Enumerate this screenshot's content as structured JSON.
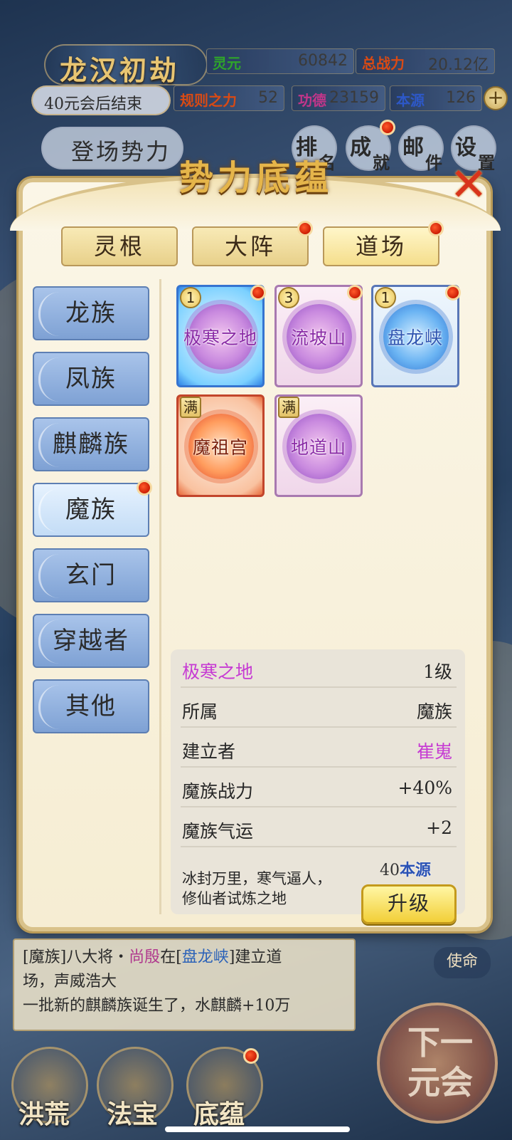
{
  "header": {
    "era_title": "龙汉初劫",
    "countdown": "40元会后结束",
    "forces_button": "登场势力",
    "stats": [
      {
        "label": "灵元",
        "value": "60842",
        "color": "#2fa52a"
      },
      {
        "label": "总战力",
        "value": "20.12亿",
        "color": "#d94a14"
      },
      {
        "label": "规则之力",
        "value": "52",
        "color": "#d94a14"
      },
      {
        "label": "功德",
        "value": "23159",
        "color": "#c2368a"
      },
      {
        "label": "本源",
        "value": "126",
        "color": "#2d58c8"
      }
    ],
    "plus": "+",
    "menu": [
      {
        "a": "排",
        "b": "名"
      },
      {
        "a": "成",
        "b": "就"
      },
      {
        "a": "邮",
        "b": "件"
      },
      {
        "a": "设",
        "b": "置"
      }
    ]
  },
  "modal": {
    "title": "势力底蕴",
    "close": "✕",
    "tabs": [
      "灵根",
      "大阵",
      "道场"
    ],
    "categories": [
      "龙族",
      "凤族",
      "麒麟族",
      "魔族",
      "玄门",
      "穿越者",
      "其他"
    ],
    "sites": [
      {
        "name": "极寒之地",
        "badge": "1",
        "style": "blue-sel"
      },
      {
        "name": "流坡山",
        "badge": "3",
        "style": "purple"
      },
      {
        "name": "盘龙峡",
        "badge": "1",
        "style": "blue"
      },
      {
        "name": "魔祖宫",
        "badge": "满",
        "style": "red"
      },
      {
        "name": "地道山",
        "badge": "满",
        "style": "purple"
      }
    ],
    "detail": {
      "name": "极寒之地",
      "level": "1级",
      "rows": [
        {
          "k": "所属",
          "v": "魔族"
        },
        {
          "k": "建立者",
          "v": "崔嵬"
        },
        {
          "k": "魔族战力",
          "v": "+40%"
        },
        {
          "k": "魔族气运",
          "v": "+2"
        }
      ],
      "desc_line1": "冰封万里，寒气逼人，",
      "desc_line2": "修仙者试炼之地",
      "cost_num": "40",
      "cost_unit": "本源",
      "upgrade": "升级"
    }
  },
  "log": {
    "line1_a": "[魔族]八大将・",
    "line1_b": "尚殷",
    "line1_c": "在[",
    "line1_d": "盘龙峡",
    "line1_e": "]建立道",
    "line2": "场，声威浩大",
    "line3": "一批新的麒麟族诞生了，水麒麟+10万"
  },
  "side_tag": "使命",
  "bottom_nav": [
    "洪荒",
    "法宝",
    "底蕴"
  ],
  "next_button": "下一元会"
}
